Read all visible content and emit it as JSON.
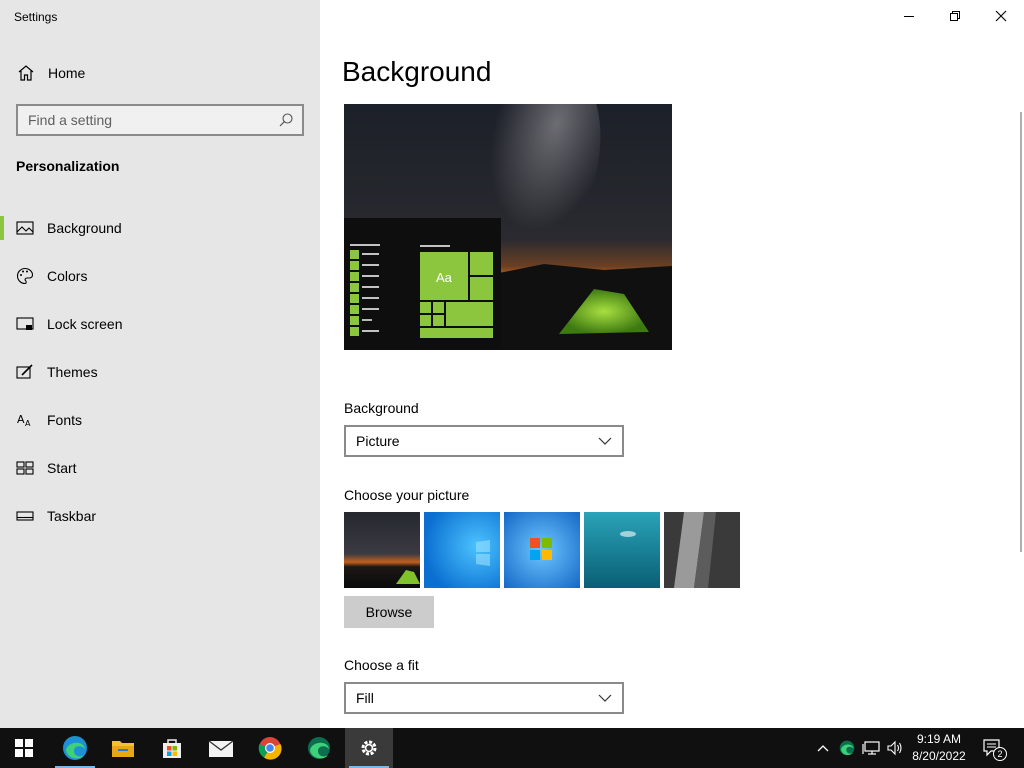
{
  "window": {
    "title": "Settings"
  },
  "sidebar": {
    "home_label": "Home",
    "search_placeholder": "Find a setting",
    "section_title": "Personalization",
    "items": [
      {
        "label": "Background",
        "icon": "picture-icon",
        "selected": true
      },
      {
        "label": "Colors",
        "icon": "palette-icon",
        "selected": false
      },
      {
        "label": "Lock screen",
        "icon": "lock-screen-icon",
        "selected": false
      },
      {
        "label": "Themes",
        "icon": "themes-icon",
        "selected": false
      },
      {
        "label": "Fonts",
        "icon": "fonts-icon",
        "selected": false
      },
      {
        "label": "Start",
        "icon": "start-icon",
        "selected": false
      },
      {
        "label": "Taskbar",
        "icon": "taskbar-icon",
        "selected": false
      }
    ]
  },
  "main": {
    "page_title": "Background",
    "preview_tile_text": "Aa",
    "background_label": "Background",
    "background_value": "Picture",
    "choose_picture_label": "Choose your picture",
    "browse_label": "Browse",
    "choose_fit_label": "Choose a fit",
    "fit_value": "Fill"
  },
  "taskbar": {
    "apps": [
      "start-icon",
      "edge-icon",
      "file-explorer-icon",
      "store-icon",
      "mail-icon",
      "chrome-icon",
      "edge-dev-icon",
      "settings-icon"
    ],
    "time": "9:19 AM",
    "date": "8/20/2022",
    "notification_count": "2"
  },
  "colors": {
    "accent": "#8cc63f",
    "taskbar": "#101010",
    "sidebar": "#e6e6e6"
  }
}
